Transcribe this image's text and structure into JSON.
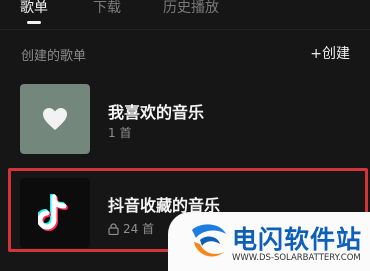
{
  "tabs": [
    {
      "label": "歌单"
    },
    {
      "label": "下载"
    },
    {
      "label": "历史播放"
    }
  ],
  "section": {
    "title": "创建的歌单",
    "create_label": "+创建"
  },
  "playlists": [
    {
      "title": "我喜欢的音乐",
      "count": "1 首",
      "cover_icon": "heart-icon"
    },
    {
      "title": "抖音收藏的音乐",
      "count": "24 首",
      "cover_icon": "tiktok-logo-icon",
      "lock_icon": "lock-icon"
    }
  ],
  "colors": {
    "highlight": "#d2343c",
    "heart_cover": "#73877d",
    "watermark_blue": "#0d5fb8"
  },
  "watermark": {
    "name": "电闪软件站",
    "url": "WWW.DS-SOLARBATTERY.COM"
  }
}
